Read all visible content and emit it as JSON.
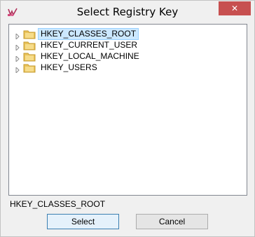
{
  "window": {
    "title": "Select Registry Key",
    "close_glyph": "✕"
  },
  "tree": {
    "items": [
      {
        "label": "HKEY_CLASSES_ROOT",
        "selected": true,
        "icon": "folder-icon"
      },
      {
        "label": "HKEY_CURRENT_USER",
        "selected": false,
        "icon": "folder-icon"
      },
      {
        "label": "HKEY_LOCAL_MACHINE",
        "selected": false,
        "icon": "folder-icon"
      },
      {
        "label": "HKEY_USERS",
        "selected": false,
        "icon": "folder-icon"
      }
    ]
  },
  "selected_path": "HKEY_CLASSES_ROOT",
  "buttons": {
    "select_label": "Select",
    "cancel_label": "Cancel"
  },
  "colors": {
    "close_button": "#c75050",
    "selection_bg": "#cce8ff",
    "folder": "#e8c25a"
  }
}
